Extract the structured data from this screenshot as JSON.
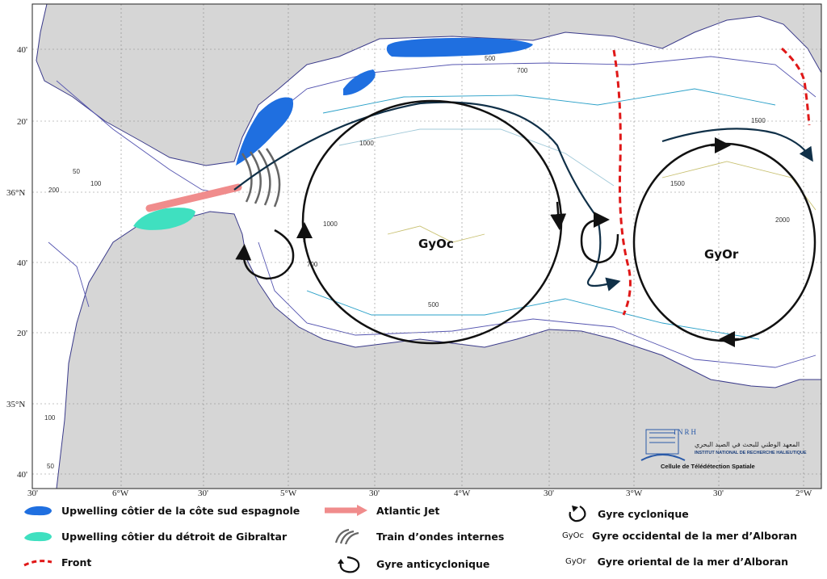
{
  "map": {
    "lat_labels": [
      "40'",
      "20'",
      "36°N",
      "40'",
      "20'",
      "35°N",
      "40'"
    ],
    "lon_labels": [
      "30'",
      "6°W",
      "30'",
      "5°W",
      "30'",
      "4°W",
      "30'",
      "3°W",
      "30'",
      "2°W"
    ],
    "contour_labels": [
      "50",
      "100",
      "200",
      "500",
      "700",
      "1000",
      "1500",
      "2000"
    ],
    "gyres": [
      {
        "code": "GyOc",
        "type": "anticyclonic"
      },
      {
        "code": "GyOr",
        "type": "anticyclonic"
      }
    ],
    "colors": {
      "land": "#d6d6d6",
      "sea": "#ffffff",
      "upwelling_spain": "#1f6fe0",
      "upwelling_gibraltar": "#3fe0c0",
      "atlantic_jet": "#f08c8c",
      "front": "#e01818",
      "gyre_line": "#111111",
      "jet_line": "#103048"
    }
  },
  "legend": [
    {
      "icon": "blue-blob",
      "label": "Upwelling côtier de la côte sud espagnole"
    },
    {
      "icon": "teal-blob",
      "label": "Upwelling côtier du détroit de Gibraltar"
    },
    {
      "icon": "red-dashed-line",
      "label": "Front"
    },
    {
      "icon": "pink-arrow",
      "label": "Atlantic Jet"
    },
    {
      "icon": "internal-waves",
      "label": "Train d’ondes internes"
    },
    {
      "icon": "anticyclonic-arrow",
      "label": "Gyre anticyclonique"
    },
    {
      "icon": "cyclonic-arrow",
      "label": "Gyre cyclonique"
    },
    {
      "abbr": "GyOc",
      "label": "Gyre occidental de la mer d’Alboran"
    },
    {
      "abbr": "GyOr",
      "label": "Gyre oriental de la mer d’Alboran"
    }
  ],
  "logo": {
    "acronym": "INRH",
    "arabic_name": "المعهد الوطني للبحث في الصيد البحري",
    "french_name": "INSTITUT NATIONAL DE RECHERCHE HALIEUTIQUE",
    "unit": "Cellule de Télédétection Spatiale"
  }
}
